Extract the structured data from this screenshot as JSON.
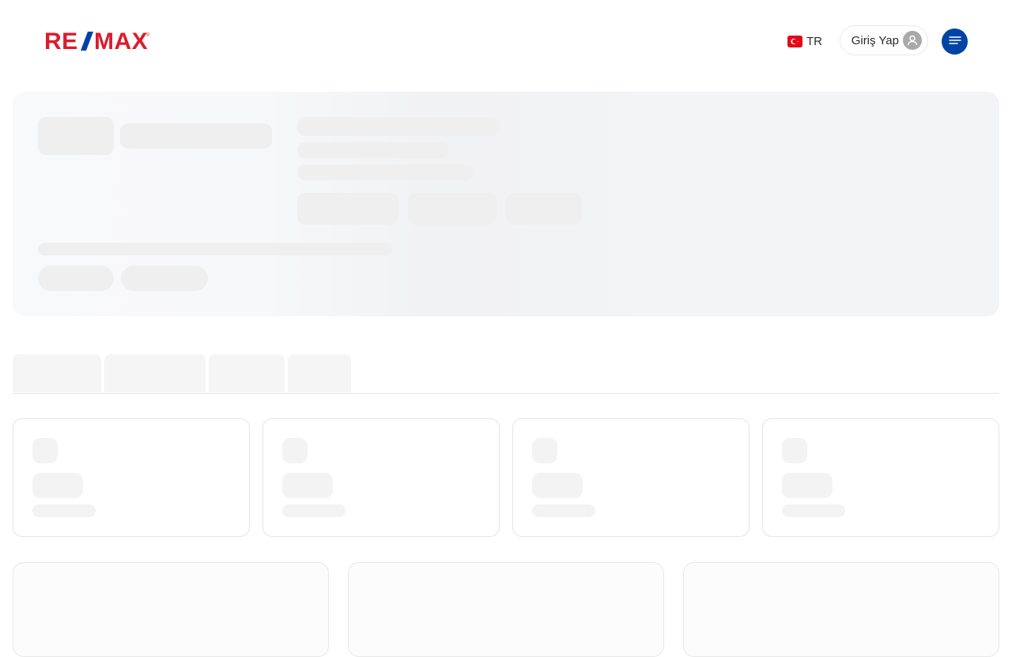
{
  "header": {
    "logo_text": "RE/MAX",
    "brand": {
      "red": "#dc1c2e",
      "blue": "#0043a6"
    },
    "language": {
      "code": "TR",
      "flag_icon": "turkey-flag-icon"
    },
    "login_label": "Giriş Yap",
    "login_icon": "user-avatar-icon",
    "menu_icon": "hamburger-menu-icon"
  }
}
